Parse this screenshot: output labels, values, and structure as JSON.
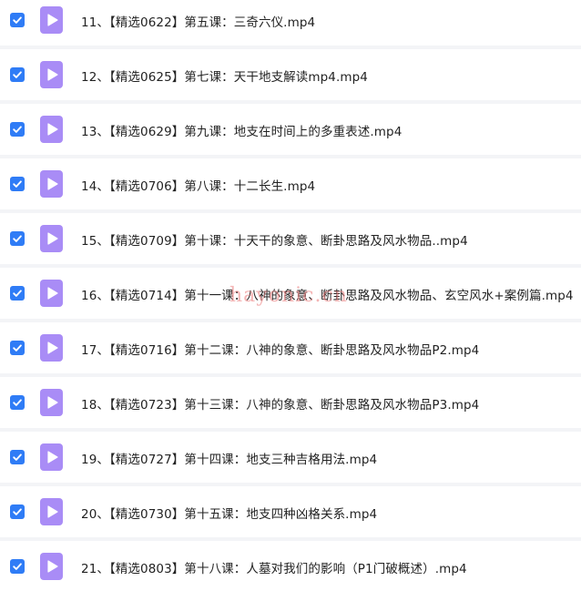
{
  "colors": {
    "checkbox": "#2f7cf6",
    "video_icon": "#a98cf6",
    "background": "#f3f4f7",
    "row": "#ffffff",
    "text": "#222222",
    "watermark": "#eb7878"
  },
  "icons": {
    "checkbox": "checkmark-icon",
    "file": "video-file-icon"
  },
  "files": [
    {
      "name": "11、【精选0622】第五课：三奇六仪.mp4",
      "checked": true
    },
    {
      "name": "12、【精选0625】第七课：天干地支解读mp4.mp4",
      "checked": true
    },
    {
      "name": "13、【精选0629】第九课：地支在时间上的多重表述.mp4",
      "checked": true
    },
    {
      "name": "14、【精选0706】第八课：十二长生.mp4",
      "checked": true
    },
    {
      "name": "15、【精选0709】第十课：十天干的象意、断卦思路及风水物品..mp4",
      "checked": true
    },
    {
      "name": "16、【精选0714】第十一课：八神的象意、断卦思路及风水物品、玄空风水+案例篇.mp4",
      "checked": true
    },
    {
      "name": "17、【精选0716】第十二课：八神的象意、断卦思路及风水物品P2.mp4",
      "checked": true
    },
    {
      "name": "18、【精选0723】第十三课：八神的象意、断卦思路及风水物品P3.mp4",
      "checked": true
    },
    {
      "name": "19、【精选0727】第十四课：地支三种吉格用法.mp4",
      "checked": true
    },
    {
      "name": "20、【精选0730】第十五课：地支四种凶格关系.mp4",
      "checked": true
    },
    {
      "name": "21、【精选0803】第十八课：人墓对我们的影响（P1门破概述）.mp4",
      "checked": true
    }
  ],
  "watermark": "hayonic.cn"
}
